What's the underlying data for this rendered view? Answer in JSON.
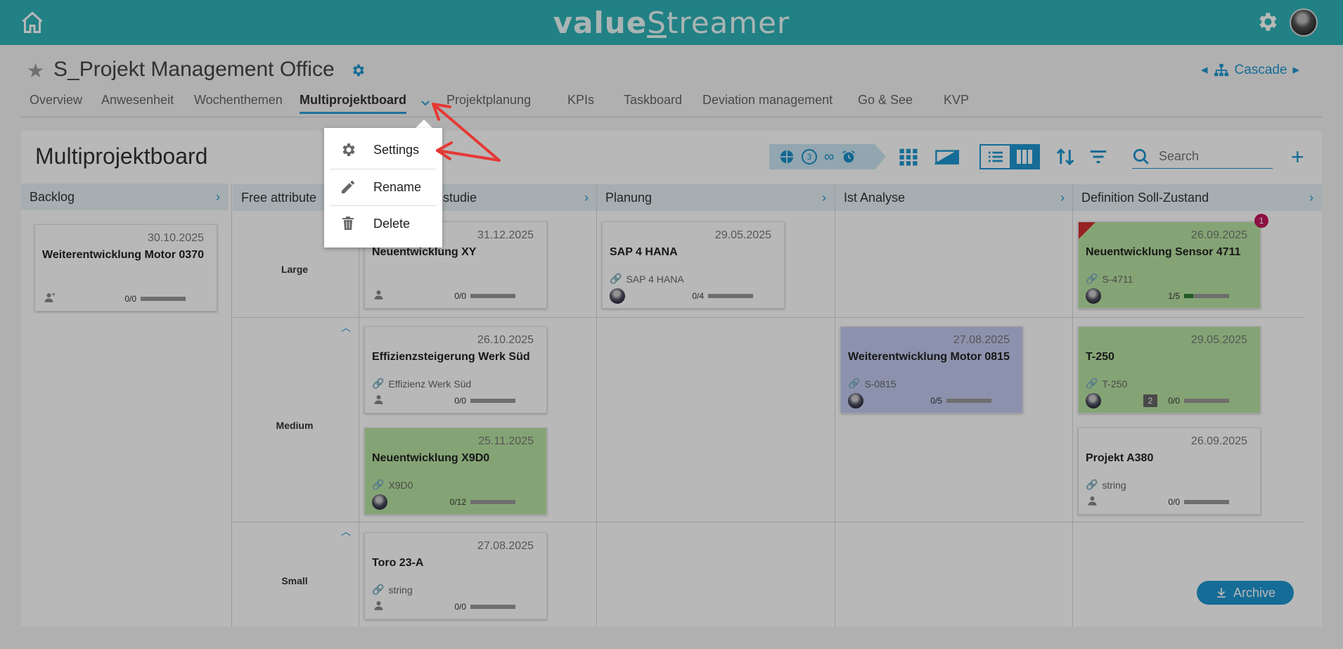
{
  "app": {
    "logo_left": "value",
    "logo_right": "treamer",
    "logo_mid": "S"
  },
  "header": {
    "title": "S_Projekt Management Office",
    "cascade_label": "Cascade"
  },
  "nav": {
    "tabs": [
      {
        "label": "Overview"
      },
      {
        "label": "Anwesenheit"
      },
      {
        "label": "Wochenthemen"
      },
      {
        "label": "Multiprojektboard"
      },
      {
        "label": "Projektplanung"
      },
      {
        "label": "KPIs"
      },
      {
        "label": "Taskboard"
      },
      {
        "label": "Deviation management"
      },
      {
        "label": "Go & See"
      },
      {
        "label": "KVP"
      }
    ],
    "active_tab": "Multiprojektboard"
  },
  "board": {
    "title": "Multiprojektboard",
    "filter_count": "3",
    "search_placeholder": "Search",
    "archive_label": "Archive"
  },
  "columns": [
    {
      "label": "Backlog"
    },
    {
      "label": "Free attribute"
    },
    {
      "label": "Machbarkeitsstudie",
      "visible_label": "sstudie"
    },
    {
      "label": "Planung"
    },
    {
      "label": "Ist Analyse"
    },
    {
      "label": "Definition Soll-Zustand"
    }
  ],
  "rows": [
    {
      "label": "Large"
    },
    {
      "label": "Medium"
    },
    {
      "label": "Small"
    }
  ],
  "cards": {
    "backlog_1": {
      "date": "30.10.2025",
      "name": "Weiterentwicklung Motor 0370",
      "count": "0/0"
    },
    "mach_large": {
      "date": "31.12.2025",
      "date_partial": "5",
      "name": "Neuentwicklung XY",
      "count": "0/0"
    },
    "mach_medium_1": {
      "date": "26.10.2025",
      "name": "Effizienzsteigerung Werk Süd",
      "link": "Effizienz Werk Süd",
      "count": "0/0"
    },
    "mach_medium_2": {
      "date": "25.11.2025",
      "name": "Neuentwicklung X9D0",
      "link": "X9D0",
      "count": "0/12"
    },
    "mach_small": {
      "date": "27.08.2025",
      "name": "Toro 23-A",
      "link": "string",
      "count": "0/0"
    },
    "plan_large": {
      "date": "29.05.2025",
      "name": "SAP 4 HANA",
      "link": "SAP 4 HANA",
      "count": "0/4"
    },
    "ist_medium": {
      "date": "27.08.2025",
      "name": "Weiterentwicklung Motor 0815",
      "link": "S-0815",
      "count": "0/5"
    },
    "def_large": {
      "date": "26.09.2025",
      "name": "Neuentwicklung Sensor 4711",
      "link": "S-4711",
      "count": "1/5",
      "progress": 0.2,
      "badge": "1"
    },
    "def_medium_1": {
      "date": "29.05.2025",
      "name": "T-250",
      "link": "T-250",
      "count": "0/0",
      "num_badge": "2"
    },
    "def_medium_2": {
      "date": "26.09.2025",
      "name": "Projekt A380",
      "link": "string",
      "count": "0/0"
    }
  },
  "menu": {
    "items": [
      {
        "label": "Settings",
        "icon": "gear-icon"
      },
      {
        "label": "Rename",
        "icon": "pencil-icon"
      },
      {
        "label": "Delete",
        "icon": "trash-icon"
      }
    ]
  },
  "colors": {
    "topbar": "#2fb3b8",
    "accent": "#1e96d0",
    "card_green": "#b9e3a3",
    "card_purple": "#c3cbf0",
    "annotation_arrow": "#e53935"
  }
}
